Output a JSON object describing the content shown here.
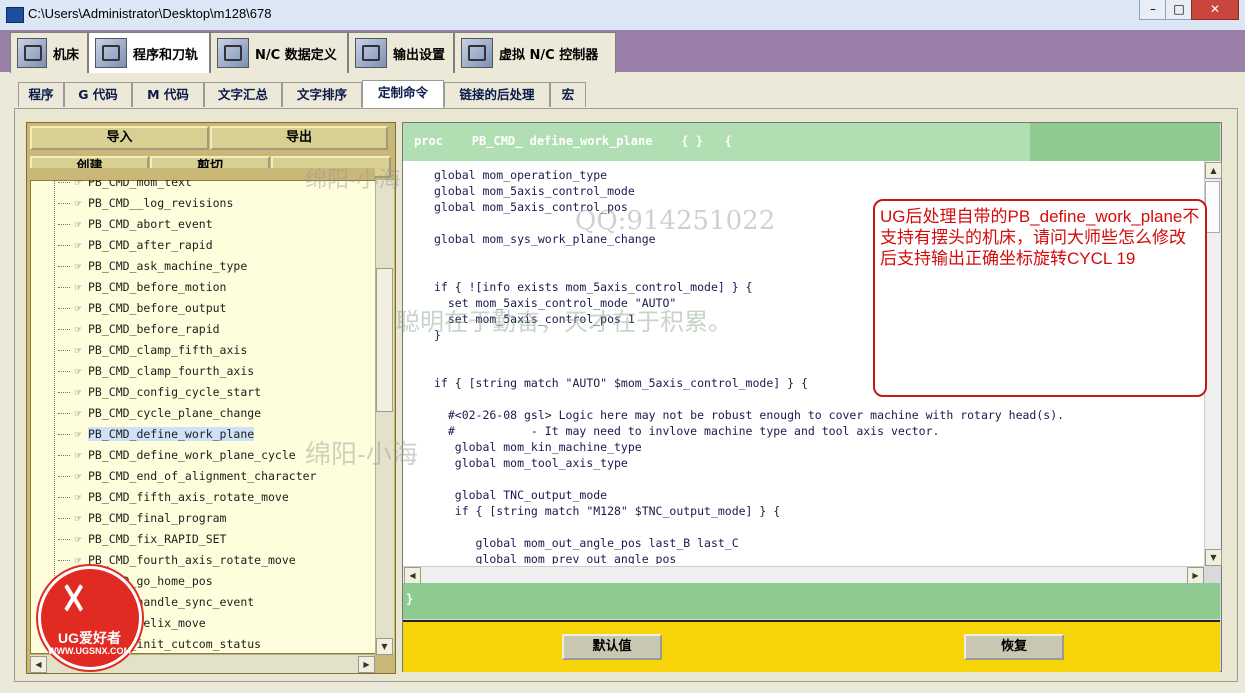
{
  "window": {
    "title": "C:\\Users\\Administrator\\Desktop\\m128\\678",
    "min_icon": "minimize-icon",
    "max_icon": "maximize-icon",
    "close_icon": "close-icon",
    "min": "–",
    "max": "□",
    "close": "✕"
  },
  "main_tabs": [
    {
      "label": "机床",
      "icon": "machine-icon"
    },
    {
      "label": "程序和刀轨",
      "icon": "toolpath-icon"
    },
    {
      "label": "N/C 数据定义",
      "icon": "nc-data-icon"
    },
    {
      "label": "输出设置",
      "icon": "printer-icon"
    },
    {
      "label": "虚拟 N/C 控制器",
      "icon": "controller-icon"
    }
  ],
  "sub_tabs": [
    {
      "label": "程序"
    },
    {
      "label": "G 代码"
    },
    {
      "label": "M 代码"
    },
    {
      "label": "文字汇总"
    },
    {
      "label": "文字排序"
    },
    {
      "label": "定制命令"
    },
    {
      "label": "链接的后处理"
    },
    {
      "label": "宏"
    }
  ],
  "left": {
    "import_label": "导入",
    "export_label": "导出",
    "create_label": "创建",
    "cut_label": "剪切",
    "tree_items": [
      "PB_CMD_mom_text",
      "PB_CMD__log_revisions",
      "PB_CMD_abort_event",
      "PB_CMD_after_rapid",
      "PB_CMD_ask_machine_type",
      "PB_CMD_before_motion",
      "PB_CMD_before_output",
      "PB_CMD_before_rapid",
      "PB_CMD_clamp_fifth_axis",
      "PB_CMD_clamp_fourth_axis",
      "PB_CMD_config_cycle_start",
      "PB_CMD_cycle_plane_change",
      "PB_CMD_define_work_plane",
      "PB_CMD_define_work_plane_cycle",
      "PB_CMD_end_of_alignment_character",
      "PB_CMD_fifth_axis_rotate_move",
      "PB_CMD_final_program",
      "PB_CMD_fix_RAPID_SET",
      "PB_CMD_fourth_axis_rotate_move",
      "PB_CMD_go_home_pos",
      "PB_CMD_handle_sync_event",
      "PB_CMD_helix_move",
      "PB_CMD_init_cutcom_status"
    ],
    "selected_item": "PB_CMD_define_work_plane",
    "scroll_up": "▲",
    "scroll_down": "▼",
    "scroll_left": "◀",
    "scroll_right": "▶"
  },
  "editor": {
    "header": "proc    PB_CMD_ define_work_plane    { }   {",
    "footer": "}",
    "lines": [
      "global mom_operation_type",
      "global mom_5axis_control_mode",
      "global mom_5axis_control_pos",
      "",
      "global mom_sys_work_plane_change",
      "",
      "",
      "if { ![info exists mom_5axis_control_mode] } {",
      "  set mom_5axis_control_mode \"AUTO\"",
      "  set mom_5axis_control_pos 1",
      "}",
      "",
      "",
      "if { [string match \"AUTO\" $mom_5axis_control_mode] } {",
      "",
      "  #<02-26-08 gsl> Logic here may not be robust enough to cover machine with rotary head(s).",
      "  #           - It may need to invlove machine type and tool axis vector.",
      "   global mom_kin_machine_type",
      "   global mom_tool_axis_type",
      "",
      "   global TNC_output_mode",
      "   if { [string match \"M128\" $TNC_output_mode] } {",
      "",
      "      global mom_out_angle_pos last_B last_C",
      "      global mom_prev_out_angle_pos"
    ],
    "default_label": "默认值",
    "restore_label": "恢复"
  },
  "callout": {
    "text": "UG后处理自带的PB_define_work_plane不支持有摆头的机床，请问大师些怎么修改后支持输出正确坐标旋转CYCL 19"
  },
  "watermarks": {
    "w1": "绵阳-小海",
    "w2": "QQ:914251022",
    "w3": "聪明在于勤奋，天才在于积累。",
    "w4": "绵阳-小海"
  },
  "logo": {
    "text": "UG爱好者",
    "url": "WWW.UGSNX.COM"
  },
  "colors": {
    "accent_purple": "#9a80a8",
    "proc_green": "#b1deb3",
    "button_yellow": "#f7d407",
    "callout_red": "#c41a1a"
  }
}
